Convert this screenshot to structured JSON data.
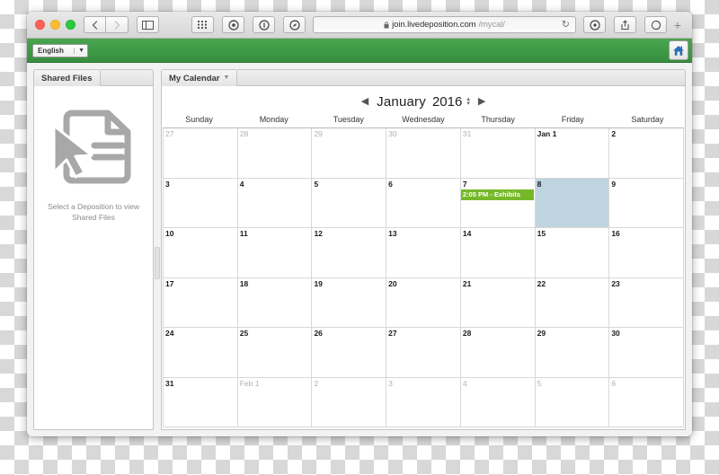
{
  "browser": {
    "traffic_lights": [
      "close",
      "minimize",
      "zoom"
    ],
    "nav": {
      "back_label": "‹",
      "forward_label": "›"
    },
    "sidebar_toggle": "sidebar-icon",
    "toolbar_icons": [
      "grid-icon",
      "target-icon",
      "info-icon",
      "compass-icon"
    ],
    "url": {
      "host": "join.livedeposition.com",
      "path": "/mycal/",
      "lock": "lock-icon"
    },
    "reload_label": "↻",
    "right_icons": [
      "share-up-icon",
      "download-icon",
      "tabs-icon"
    ],
    "new_tab_label": "+"
  },
  "appbar": {
    "language_value": "English",
    "language_caret": "▼",
    "home_icon": "home-icon"
  },
  "sidebar": {
    "tab_label": "Shared Files",
    "empty_state_text": "Select a Deposition to view Shared Files",
    "empty_icon": "document-cursor-icon"
  },
  "calendar": {
    "tab_label": "My Calendar",
    "tab_caret": "▼",
    "prev_label": "◀",
    "next_label": "▶",
    "month": "January",
    "year": "2016",
    "stepper_up": "▴",
    "stepper_down": "▾",
    "day_headers": [
      "Sunday",
      "Monday",
      "Tuesday",
      "Wednesday",
      "Thursday",
      "Friday",
      "Saturday"
    ],
    "event_color": "#76b82a",
    "selected_color": "#bed4df",
    "weeks": [
      [
        {
          "label": "27",
          "other": true
        },
        {
          "label": "28",
          "other": true
        },
        {
          "label": "29",
          "other": true
        },
        {
          "label": "30",
          "other": true
        },
        {
          "label": "31",
          "other": true
        },
        {
          "label": "Jan 1",
          "other": false
        },
        {
          "label": "2",
          "other": false
        }
      ],
      [
        {
          "label": "3",
          "other": false
        },
        {
          "label": "4",
          "other": false
        },
        {
          "label": "5",
          "other": false
        },
        {
          "label": "6",
          "other": false
        },
        {
          "label": "7",
          "other": false,
          "events": [
            "2:05 PM - Exhibits"
          ]
        },
        {
          "label": "8",
          "other": false,
          "selected": true
        },
        {
          "label": "9",
          "other": false
        }
      ],
      [
        {
          "label": "10",
          "other": false
        },
        {
          "label": "11",
          "other": false
        },
        {
          "label": "12",
          "other": false
        },
        {
          "label": "13",
          "other": false
        },
        {
          "label": "14",
          "other": false
        },
        {
          "label": "15",
          "other": false
        },
        {
          "label": "16",
          "other": false
        }
      ],
      [
        {
          "label": "17",
          "other": false
        },
        {
          "label": "18",
          "other": false
        },
        {
          "label": "19",
          "other": false
        },
        {
          "label": "20",
          "other": false
        },
        {
          "label": "21",
          "other": false
        },
        {
          "label": "22",
          "other": false
        },
        {
          "label": "23",
          "other": false
        }
      ],
      [
        {
          "label": "24",
          "other": false
        },
        {
          "label": "25",
          "other": false
        },
        {
          "label": "26",
          "other": false
        },
        {
          "label": "27",
          "other": false
        },
        {
          "label": "28",
          "other": false
        },
        {
          "label": "29",
          "other": false
        },
        {
          "label": "30",
          "other": false
        }
      ],
      [
        {
          "label": "31",
          "other": false
        },
        {
          "label": "Feb 1",
          "other": true
        },
        {
          "label": "2",
          "other": true
        },
        {
          "label": "3",
          "other": true
        },
        {
          "label": "4",
          "other": true
        },
        {
          "label": "5",
          "other": true
        },
        {
          "label": "6",
          "other": true
        }
      ]
    ]
  }
}
